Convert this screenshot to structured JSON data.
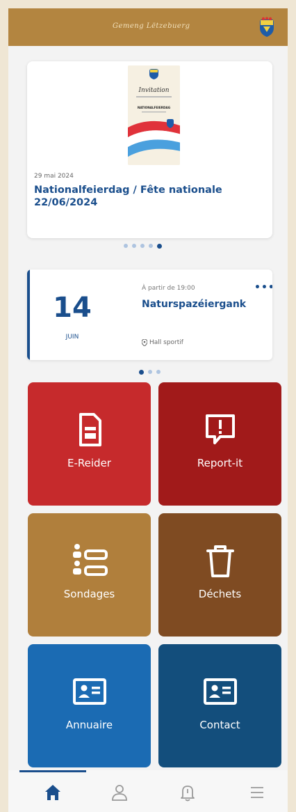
{
  "header": {
    "logo_text": "Gemeng Lëtzebuerg",
    "crest_icon": "coat-of-arms-icon"
  },
  "news": {
    "date": "29 mai 2024",
    "title": "Nationalfeierdag / Fête nationale 22/06/2024",
    "poster_title": "Invitation",
    "poster_banner": "NATIONALFEIERDAG",
    "dots": 5,
    "active_dot": 4
  },
  "event": {
    "day": "14",
    "month": "JUIN",
    "time": "À partir de 19:00",
    "title": "Naturspazéiergank",
    "more": "•••",
    "location": "Hall sportif",
    "dots": 3,
    "active_dot": 0
  },
  "tiles": [
    {
      "label": "E-Reider",
      "icon": "document-icon",
      "color": "#c62a2c"
    },
    {
      "label": "Report-it",
      "icon": "alert-message-icon",
      "color": "#a11a1a"
    },
    {
      "label": "Sondages",
      "icon": "survey-list-icon",
      "color": "#b07f3c"
    },
    {
      "label": "Déchets",
      "icon": "trash-icon",
      "color": "#7f4b22"
    },
    {
      "label": "Annuaire",
      "icon": "id-card-icon",
      "color": "#1b6bb3"
    },
    {
      "label": "Contact",
      "icon": "id-card-icon",
      "color": "#134e7c"
    }
  ],
  "nav": [
    {
      "name": "home",
      "icon": "home-icon",
      "active": true
    },
    {
      "name": "profile",
      "icon": "user-icon",
      "active": false
    },
    {
      "name": "notifications",
      "icon": "bell-icon",
      "active": false
    },
    {
      "name": "menu",
      "icon": "menu-icon",
      "active": false
    }
  ],
  "colors": {
    "primary": "#1a4e8c",
    "header": "#b38540"
  }
}
